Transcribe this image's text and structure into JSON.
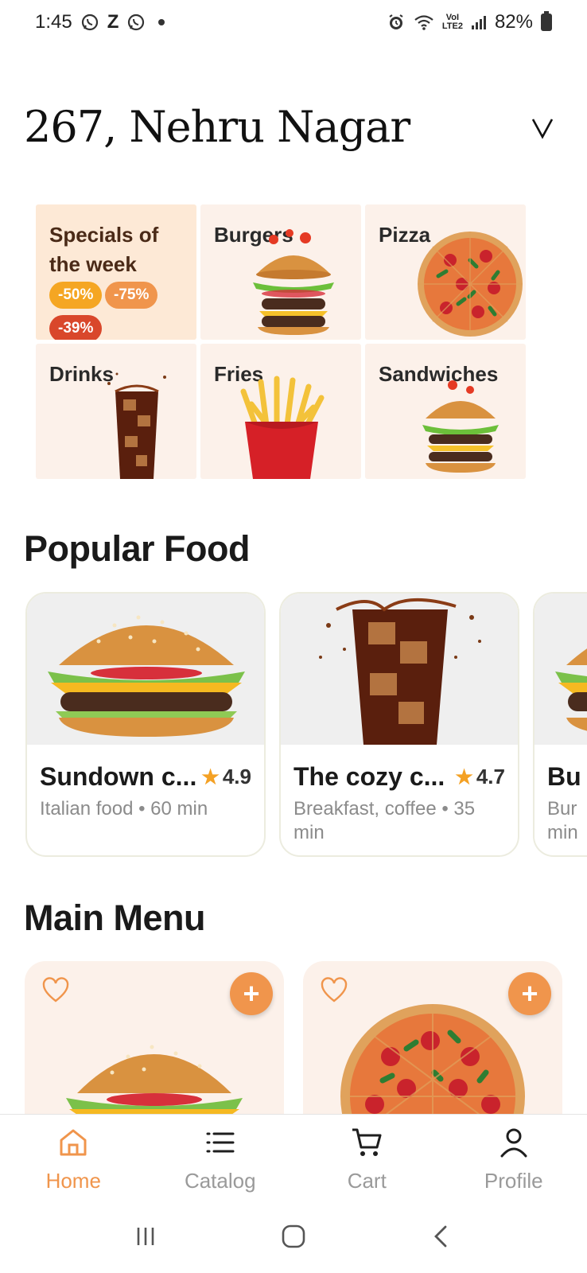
{
  "status_bar": {
    "time": "1:45",
    "notification_icons": [
      "whatsapp-icon",
      "z-icon",
      "whatsapp-icon"
    ],
    "battery": "82%",
    "network_label": "LTE2"
  },
  "header": {
    "location": "267, Nehru Nagar",
    "chevron": "V"
  },
  "categories": [
    {
      "label": "Specials of the week",
      "icon": "specials",
      "badges": [
        "-50%",
        "-75%",
        "-39%"
      ],
      "badge_colors": [
        "#f5a623",
        "#f0954c",
        "#d9472b"
      ]
    },
    {
      "label": "Burgers",
      "icon": "burger"
    },
    {
      "label": "Pizza",
      "icon": "pizza"
    },
    {
      "label": "Drinks",
      "icon": "drink"
    },
    {
      "label": "Fries",
      "icon": "fries"
    },
    {
      "label": "Sandwiches",
      "icon": "sandwich"
    }
  ],
  "popular": {
    "title": "Popular Food",
    "items": [
      {
        "name": "Sundown c...",
        "rating": "4.9",
        "subtitle": "Italian food • 60 min",
        "image": "burger"
      },
      {
        "name": "The cozy c...",
        "rating": "4.7",
        "subtitle": "Breakfast, coffee • 35 min",
        "image": "drink"
      },
      {
        "name": "Bu",
        "rating": "",
        "subtitle": "Bur min",
        "image": "burger"
      }
    ]
  },
  "main_menu": {
    "title": "Main Menu",
    "items": [
      {
        "image": "burger",
        "add_symbol": "+"
      },
      {
        "image": "pizza",
        "add_symbol": "+"
      }
    ]
  },
  "bottom_nav": {
    "items": [
      {
        "label": "Home",
        "icon": "home-icon",
        "active": true
      },
      {
        "label": "Catalog",
        "icon": "list-icon",
        "active": false
      },
      {
        "label": "Cart",
        "icon": "cart-icon",
        "active": false
      },
      {
        "label": "Profile",
        "icon": "profile-icon",
        "active": false
      }
    ]
  },
  "colors": {
    "accent": "#f0954c",
    "tile_bg": "#fcf1ea",
    "specials_bg": "#fde9d6",
    "star": "#f4a124",
    "muted_text": "#8b8b8b"
  }
}
